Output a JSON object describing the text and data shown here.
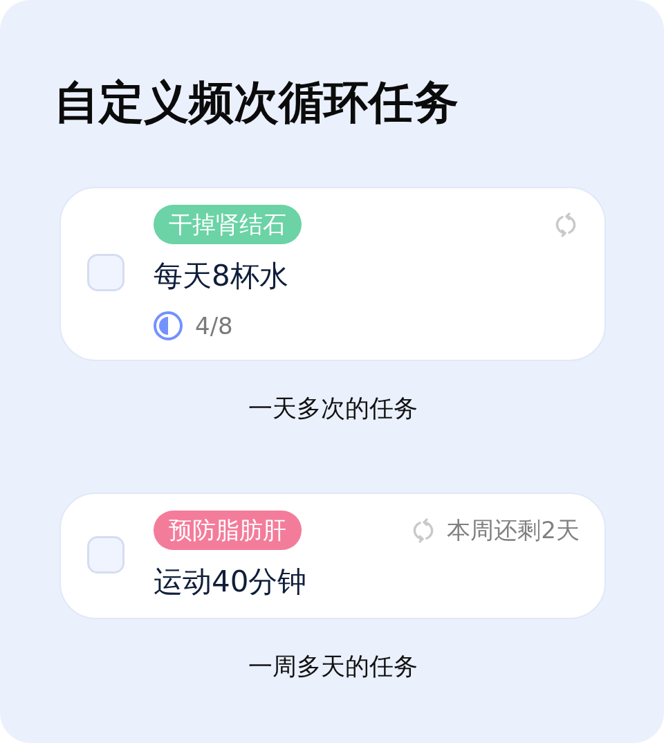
{
  "title": "自定义频次循环任务",
  "sections": [
    {
      "task": {
        "tag": {
          "label": "干掉肾结石",
          "color": "#6bd3a5"
        },
        "name": "每天8杯水",
        "checked": false,
        "progress": {
          "level": 0.5,
          "reading": "4/8"
        }
      },
      "caption": "一天多次的任务"
    },
    {
      "task": {
        "tag": {
          "label": "预防脂肪肝",
          "color": "#f47c9b"
        },
        "name": "运动40分钟",
        "checked": false,
        "remaining": "本周还剩2天"
      },
      "caption": "一周多天的任务"
    }
  ]
}
